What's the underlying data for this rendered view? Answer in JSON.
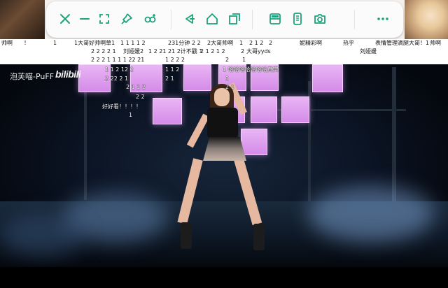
{
  "toolbar": {
    "buttons": [
      {
        "name": "close-button",
        "icon": "close-icon"
      },
      {
        "name": "minimize-button",
        "icon": "minus-icon"
      },
      {
        "name": "fullscreen-button",
        "icon": "fullscreen-icon"
      },
      {
        "name": "pin-button",
        "icon": "pin-icon"
      },
      {
        "name": "screen-record-button",
        "icon": "record-icon"
      },
      {
        "name": "back-button",
        "icon": "back-icon"
      },
      {
        "name": "home-button",
        "icon": "home-icon"
      },
      {
        "name": "recent-apps-button",
        "icon": "recent-icon"
      },
      {
        "name": "split-screen-button",
        "icon": "split-icon"
      },
      {
        "name": "phone-button",
        "icon": "phone-icon"
      },
      {
        "name": "screenshot-button",
        "icon": "camera-icon"
      },
      {
        "name": "more-button",
        "icon": "more-icon"
      }
    ],
    "icon_color": "#1aa37a"
  },
  "video": {
    "watermark_name": "泡芙喵-PuFF",
    "watermark_logo": "bilibili"
  },
  "danmaku": {
    "row1": [
      {
        "text": "帅啊"
      },
      {
        "text": "！"
      },
      {
        "text": "1"
      },
      {
        "text": "1大哥好帅啊草1"
      },
      {
        "text": "1  1  1  1  2"
      },
      {
        "text": "231分钟"
      },
      {
        "text": "2  2"
      },
      {
        "text": "2大哥帅啊"
      },
      {
        "text": "1"
      },
      {
        "text": "2 1 2"
      },
      {
        "text": "2"
      },
      {
        "text": "妮精彩啊"
      },
      {
        "text": "热乎"
      },
      {
        "text": "表情管理滴腿大哥！1"
      },
      {
        "text": "帅啊"
      }
    ],
    "row2": [
      {
        "text": "2  2 2 2  1"
      },
      {
        "text": "刘娅媛2"
      },
      {
        "text": "1 2 21 21 2计不戳 1"
      },
      {
        "text": "2  1  2  1  2"
      },
      {
        "text": "2"
      },
      {
        "text": "大哥yyds"
      },
      {
        "text": "刘娅媛"
      }
    ],
    "row3": [
      {
        "text": "2  2  2  1  1 1 1  22 21"
      },
      {
        "text": "1  2 2  2"
      },
      {
        "text": "2"
      },
      {
        "text": "1"
      }
    ],
    "overlay": [
      {
        "text": "1  1  2 12 2"
      },
      {
        "text": "1   1  2"
      },
      {
        "text": "1  哈哈哈哈哈哈哈真实"
      },
      {
        "text": "2  22 2  1"
      },
      {
        "text": "2  1"
      },
      {
        "text": "2  1  1  2"
      },
      {
        "text": "2  2"
      },
      {
        "text": "好好看！！！！"
      },
      {
        "text": "1"
      },
      {
        "text": "1"
      },
      {
        "text": "2  1"
      }
    ]
  }
}
